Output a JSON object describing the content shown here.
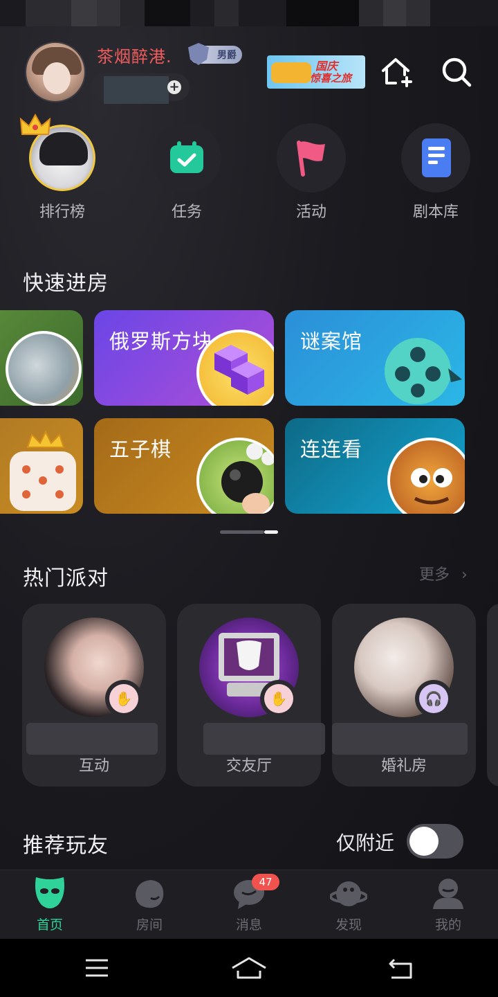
{
  "user": {
    "name": "茶烟醉港.",
    "badge": "男爵"
  },
  "banner": {
    "line1": "国庆",
    "line2": "惊喜之旅"
  },
  "quick_nav": [
    {
      "label": "排行榜",
      "icon": "ranking-avatar-icon"
    },
    {
      "label": "任务",
      "icon": "task-calendar-check-icon"
    },
    {
      "label": "活动",
      "icon": "flag-icon"
    },
    {
      "label": "剧本库",
      "icon": "script-book-icon"
    }
  ],
  "quick_enter": {
    "title": "快速进房",
    "games": [
      {
        "name": "俄罗斯方块",
        "color_from": "#6a46e6",
        "color_to": "#b04fd6"
      },
      {
        "name": "谜案馆",
        "color_from": "#2b8fd8",
        "color_to": "#2bb7e6"
      },
      {
        "name": "五子棋",
        "color_from": "#a56a18",
        "color_to": "#c98c22"
      },
      {
        "name": "连连看",
        "color_from": "#0e6a86",
        "color_to": "#14a5d2"
      }
    ]
  },
  "hot_party": {
    "title": "热门派对",
    "more": "更多",
    "rooms": [
      {
        "label": "互动",
        "tag_icon": "wave-hand-icon"
      },
      {
        "label": "交友厅",
        "tag_icon": "wave-hand-icon"
      },
      {
        "label": "婚礼房",
        "tag_icon": "headphones-icon"
      }
    ]
  },
  "recommend": {
    "title": "推荐玩友",
    "nearby_label": "仅附近",
    "nearby_on": false
  },
  "tabs": [
    {
      "label": "首页",
      "active": true,
      "icon": "mask-icon"
    },
    {
      "label": "房间",
      "active": false,
      "icon": "room-icon"
    },
    {
      "label": "消息",
      "active": false,
      "icon": "message-icon",
      "badge": "47"
    },
    {
      "label": "发现",
      "active": false,
      "icon": "planet-icon"
    },
    {
      "label": "我的",
      "active": false,
      "icon": "profile-icon"
    }
  ],
  "colors": {
    "accent": "#2fd39a",
    "username": "#f05d5d",
    "badge_red": "#f0534d"
  }
}
